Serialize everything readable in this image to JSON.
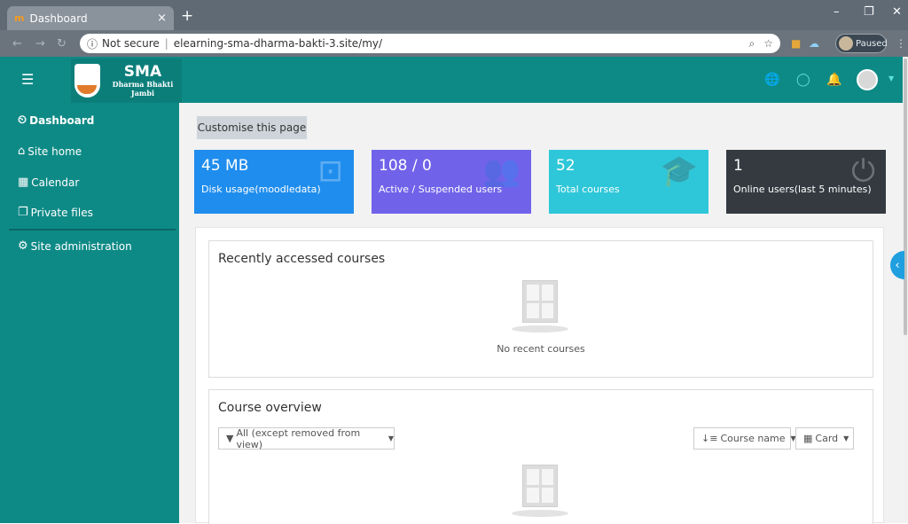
{
  "browser": {
    "tab_title": "Dashboard",
    "tab_favicon": "m",
    "tab_close": "×",
    "new_tab": "+",
    "security_label": "Not secure",
    "url": "elearning-sma-dharma-bakti-3.site/my/",
    "profile_status": "Paused",
    "window_controls": {
      "minimize": "–",
      "restore": "❐",
      "close": "✕"
    }
  },
  "header": {
    "menu_icon": "☰",
    "logo_title": "SMA",
    "logo_subtitle": "Dharma Bhakti Jambi",
    "icons": {
      "language": "🌐",
      "messages": "◯",
      "notifications": "🔔",
      "user_caret": "▼"
    }
  },
  "sidebar": {
    "items": [
      {
        "label": "Dashboard",
        "icon": "dashboard-icon",
        "glyph": "⏲"
      },
      {
        "label": "Site home",
        "icon": "home-icon",
        "glyph": "⌂"
      },
      {
        "label": "Calendar",
        "icon": "calendar-icon",
        "glyph": "▦"
      },
      {
        "label": "Private files",
        "icon": "files-icon",
        "glyph": "❐"
      },
      {
        "label": "Site administration",
        "icon": "gear-icon",
        "glyph": "⚙"
      }
    ]
  },
  "main": {
    "customise_label": "Customise this page",
    "stats": [
      {
        "value": "45 MB",
        "label": "Disk usage(moodledata)",
        "color": "#1f8ded",
        "icon": "inbox-icon",
        "glyph": "⊡"
      },
      {
        "value": "108 / 0",
        "label": "Active / Suspended users",
        "color": "#7063e9",
        "icon": "users-icon",
        "glyph": "👥"
      },
      {
        "value": "52",
        "label": "Total courses",
        "color": "#2ec7d9",
        "icon": "graduation-cap-icon",
        "glyph": "🎓"
      },
      {
        "value": "1",
        "label": "Online users(last 5 minutes)",
        "color": "#343a40",
        "icon": "plug-icon",
        "glyph": "⏻"
      }
    ],
    "recent": {
      "title": "Recently accessed courses",
      "empty_text": "No recent courses"
    },
    "overview": {
      "title": "Course overview",
      "filter_label": "All (except removed from view)",
      "sort_label": "Course name",
      "view_label": "Card"
    }
  },
  "colors": {
    "brand_teal": "#0e8a86",
    "accent_blue": "#1f9fe0"
  }
}
